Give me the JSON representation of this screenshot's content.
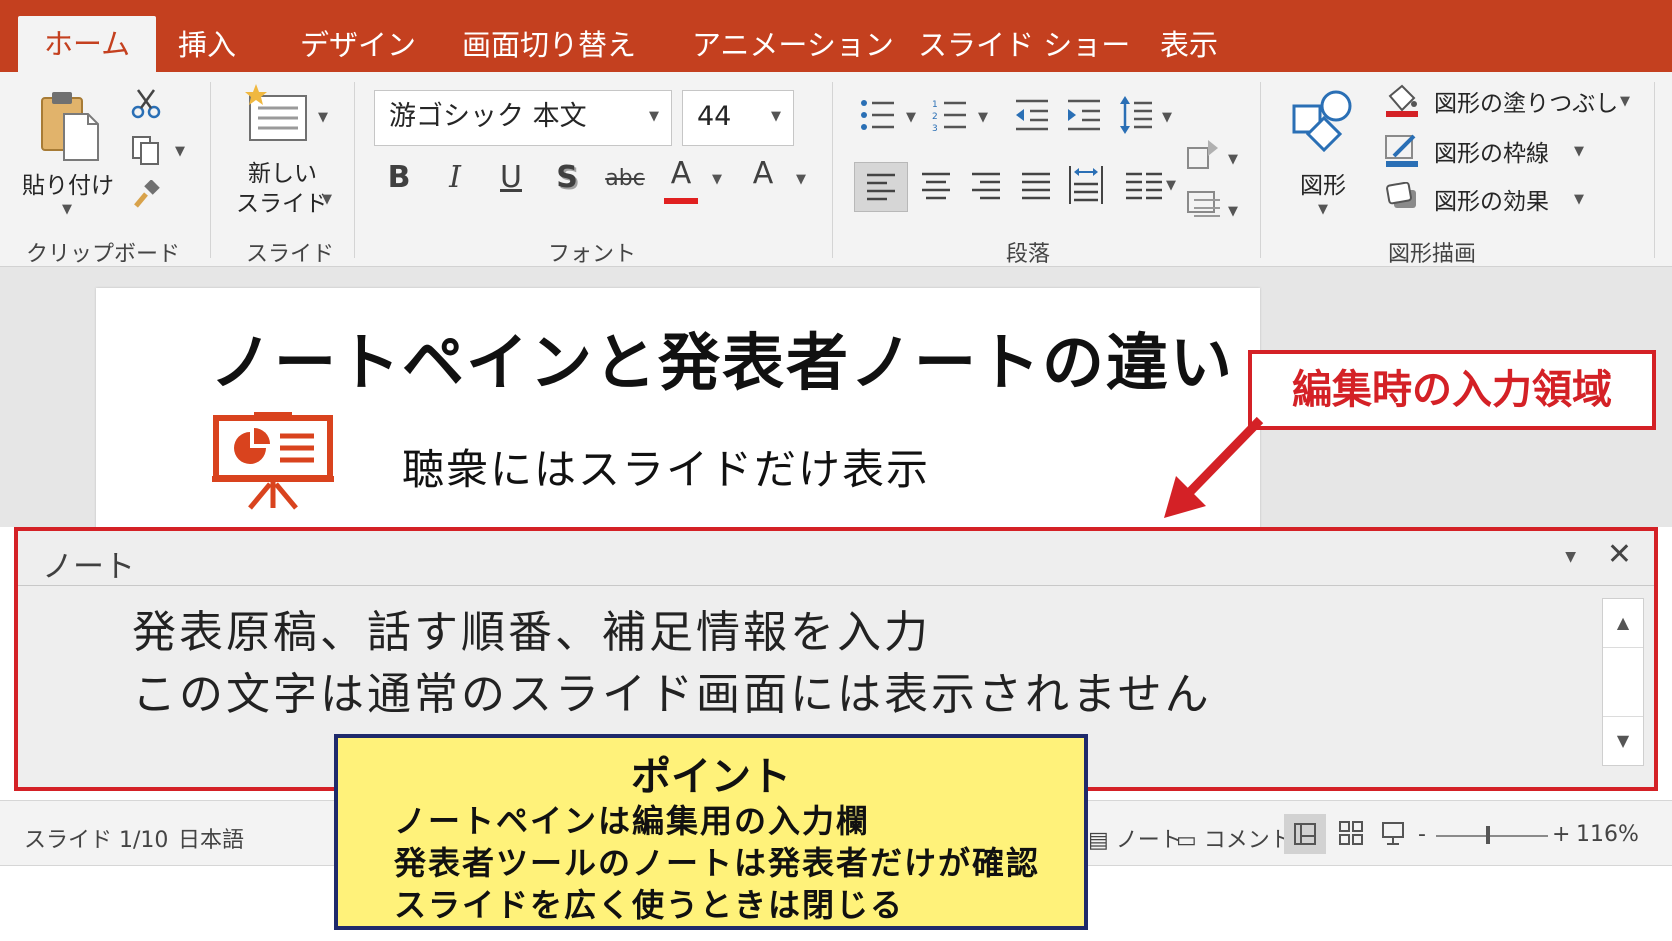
{
  "tabs": [
    {
      "label": "ホーム",
      "active": true
    },
    {
      "label": "挿入"
    },
    {
      "label": "デザイン"
    },
    {
      "label": "画面切り替え"
    },
    {
      "label": "アニメーション"
    },
    {
      "label": "スライド ショー"
    },
    {
      "label": "表示"
    }
  ],
  "ribbon": {
    "clipboard": {
      "paste_label": "貼り付け",
      "group_label": "クリップボード"
    },
    "slides": {
      "new_slide_line1": "新しい",
      "new_slide_line2": "スライド",
      "group_label": "スライド"
    },
    "font": {
      "font_name": "游ゴシック 本文",
      "font_size": "44",
      "bold": "B",
      "italic": "I",
      "underline": "U",
      "shadow": "S",
      "strike": "abc",
      "color_a": "A",
      "size_a": "A",
      "group_label": "フォント"
    },
    "paragraph": {
      "group_label": "段落"
    },
    "drawing": {
      "shapes_label": "図形",
      "fill_label": "図形の塗りつぶし",
      "outline_label": "図形の枠線",
      "effect_label": "図形の効果",
      "group_label": "図形描画"
    }
  },
  "slide": {
    "title": "ノートペインと発表者ノートの違い",
    "body": "聴衆にはスライドだけ表示"
  },
  "callout": {
    "text": "編集時の入力領域"
  },
  "notes": {
    "label": "ノート",
    "line1": "発表原稿、話す順番、補足情報を入力",
    "line2": "この文字は通常のスライド画面には表示されません"
  },
  "statusbar": {
    "slide_count": "スライド 1/10",
    "language": "日本語",
    "notes_label": "ノート",
    "comment_label": "コメント",
    "zoom_minus": "-",
    "zoom_plus": "+",
    "zoom": "116%"
  },
  "point_box": {
    "title": "ポイント",
    "lines": [
      "ノートペインは編集用の入力欄",
      "発表者ツールのノートは発表者だけが確認",
      "スライドを広く使うときは閉じる"
    ]
  },
  "colors": {
    "accent": "#c4401f",
    "callout_red": "#d42126",
    "point_yellow": "#fff27a",
    "point_border": "#1f2a6b"
  }
}
